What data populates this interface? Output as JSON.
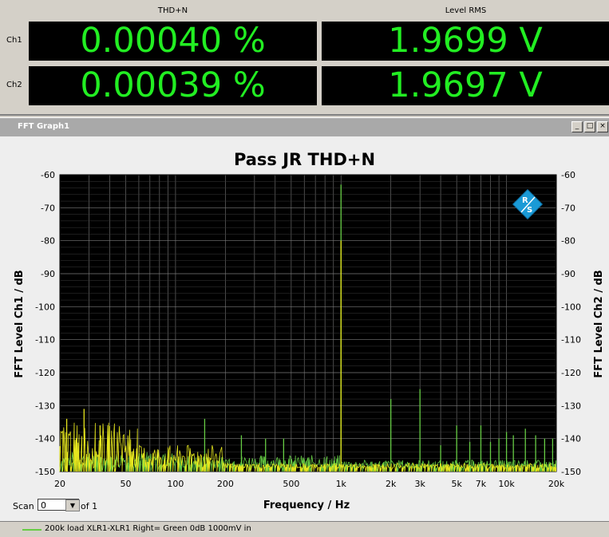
{
  "meters": {
    "columns": [
      "THD+N",
      "Level RMS"
    ],
    "rows": [
      {
        "label": "Ch1",
        "thd": "0.00040 %",
        "level": "1.9699 V"
      },
      {
        "label": "Ch2",
        "thd": "0.00039 %",
        "level": "1.9697 V"
      }
    ],
    "text_color": "#22ee22"
  },
  "window": {
    "title": "FFT Graph1",
    "buttons": [
      "_",
      "□",
      "×"
    ]
  },
  "scan": {
    "label": "Scan",
    "value": "0",
    "suffix": "of 1"
  },
  "legend": {
    "text": "200k load XLR1-XLR1 Right= Green  0dB 1000mV in",
    "color": "#66cc44"
  },
  "chart_data": {
    "type": "line",
    "title": "Pass JR THD+N",
    "xlabel": "Frequency / Hz",
    "ylabel_left": "FFT Level Ch1 / dB",
    "ylabel_right": "FFT Level Ch2 / dB",
    "x_scale": "log",
    "xlim": [
      20,
      20000
    ],
    "ylim": [
      -150,
      -60
    ],
    "x_ticks": [
      {
        "v": 20,
        "label": "20"
      },
      {
        "v": 50,
        "label": "50"
      },
      {
        "v": 100,
        "label": "100"
      },
      {
        "v": 200,
        "label": "200"
      },
      {
        "v": 500,
        "label": "500"
      },
      {
        "v": 1000,
        "label": "1k"
      },
      {
        "v": 2000,
        "label": "2k"
      },
      {
        "v": 3000,
        "label": "3k"
      },
      {
        "v": 5000,
        "label": "5k"
      },
      {
        "v": 7000,
        "label": "7k"
      },
      {
        "v": 10000,
        "label": "10k"
      },
      {
        "v": 20000,
        "label": "20k"
      }
    ],
    "y_ticks": [
      -60,
      -70,
      -80,
      -90,
      -100,
      -110,
      -120,
      -130,
      -140,
      -150
    ],
    "grid": true,
    "background": "#000000",
    "series": [
      {
        "color": "#66cc44",
        "noise_floor": -148,
        "peaks": [
          {
            "f": 1000,
            "db": -63
          },
          {
            "f": 2000,
            "db": -128
          },
          {
            "f": 3000,
            "db": -125
          },
          {
            "f": 4000,
            "db": -142
          },
          {
            "f": 5000,
            "db": -136
          },
          {
            "f": 6000,
            "db": -141
          },
          {
            "f": 7000,
            "db": -136
          },
          {
            "f": 8000,
            "db": -141
          },
          {
            "f": 9000,
            "db": -140
          },
          {
            "f": 10000,
            "db": -138
          },
          {
            "f": 11000,
            "db": -139
          },
          {
            "f": 13000,
            "db": -137
          },
          {
            "f": 15000,
            "db": -139
          },
          {
            "f": 17000,
            "db": -140
          },
          {
            "f": 19000,
            "db": -140
          },
          {
            "f": 150,
            "db": -134
          },
          {
            "f": 250,
            "db": -139
          },
          {
            "f": 350,
            "db": -140
          },
          {
            "f": 450,
            "db": -140
          }
        ]
      },
      {
        "color": "#e6e61e",
        "noise_floor": -148,
        "peaks": [
          {
            "f": 1000,
            "db": -80
          },
          {
            "f": 22,
            "db": -134
          },
          {
            "f": 28,
            "db": -131
          },
          {
            "f": 35,
            "db": -136
          }
        ]
      }
    ]
  }
}
